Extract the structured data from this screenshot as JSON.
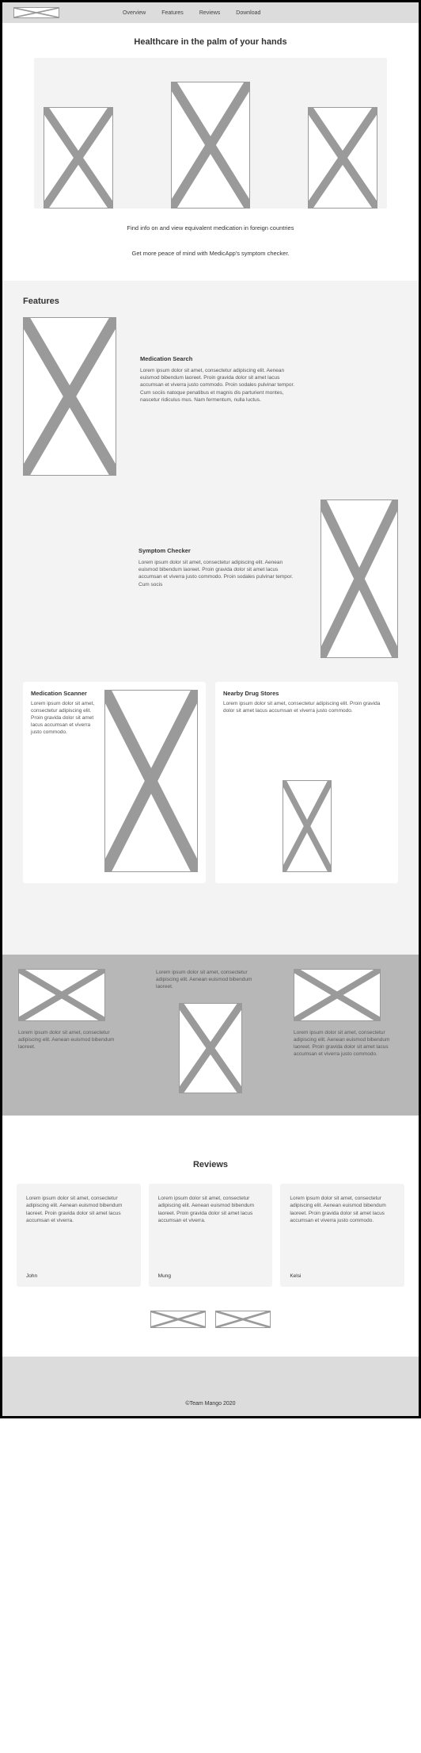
{
  "nav": {
    "links": [
      "Overview",
      "Features",
      "Reviews",
      "Download"
    ]
  },
  "hero": {
    "title": "Healthcare in the palm of your hands",
    "sub1": "Find info on and view equivalent medication in foreign countries",
    "sub2": "Get more peace of mind with MedicApp's symptom checker."
  },
  "features": {
    "heading": "Features",
    "items": [
      {
        "title": "Medication Search",
        "body": "Lorem ipsum dolor sit amet, consectetur adipiscing elit. Aenean euismod bibendum laoreet. Proin gravida dolor sit amet lacus accumsan et viverra justo commodo. Proin sodales pulvinar tempor. Cum sociis natoque penatibus et magnis dis parturient montes, nascetur ridiculus mus. Nam fermentum, nulla luctus."
      },
      {
        "title": "Symptom Checker",
        "body": "Lorem ipsum dolor sit amet, consectetur adipiscing elit. Aenean euismod bibendum laoreet. Proin gravida dolor sit amet lacus accumsan et viverra justo commodo. Proin sodales pulvinar tempor. Cum socis"
      }
    ],
    "cards": [
      {
        "title": "Medication Scanner",
        "body": "Lorem ipsum dolor sit amet, consectetur adipiscing elit. Proin gravida dolor sit amet lacus accumsan et viverra justo commodo."
      },
      {
        "title": "Nearby Drug Stores",
        "body": "Lorem ipsum dolor sit amet, consectetur adipiscing elit. Proin gravida dolor sit amet lacus accumsan et viverra justo commodo."
      }
    ]
  },
  "grey": {
    "left": "Lorem ipsum dolor sit amet, consectetur adipiscing elit. Aenean euismod bibendum laoreet.",
    "midTop": "Lorem ipsum dolor sit amet, consectetur adipiscing elit. Aenean euismod bibendum laoreet.",
    "right": "Lorem ipsum dolor sit amet, consectetur adipiscing elit. Aenean euismod bibendum laoreet. Proin gravida dolor sit amet lacus accumsan et viverra justo commodo."
  },
  "reviews": {
    "heading": "Reviews",
    "items": [
      {
        "body": "Lorem ipsum dolor sit amet, consectetur adipiscing elit. Aenean euismod bibendum laoreet. Proin gravida dolor sit amet lacus accumsan et viverra.",
        "author": "John"
      },
      {
        "body": "Lorem ipsum dolor sit amet, consectetur adipiscing elit. Aenean euismod bibendum laoreet. Proin gravida dolor sit amet lacus accumsan et viverra.",
        "author": "Mung"
      },
      {
        "body": "Lorem ipsum dolor sit amet, consectetur adipiscing elit. Aenean euismod bibendum laoreet. Proin gravida dolor sit amet lacus accumsan et viverra justo commodo.",
        "author": "Kelsi"
      }
    ]
  },
  "footer": {
    "copyright": "©Team Mango 2020"
  }
}
